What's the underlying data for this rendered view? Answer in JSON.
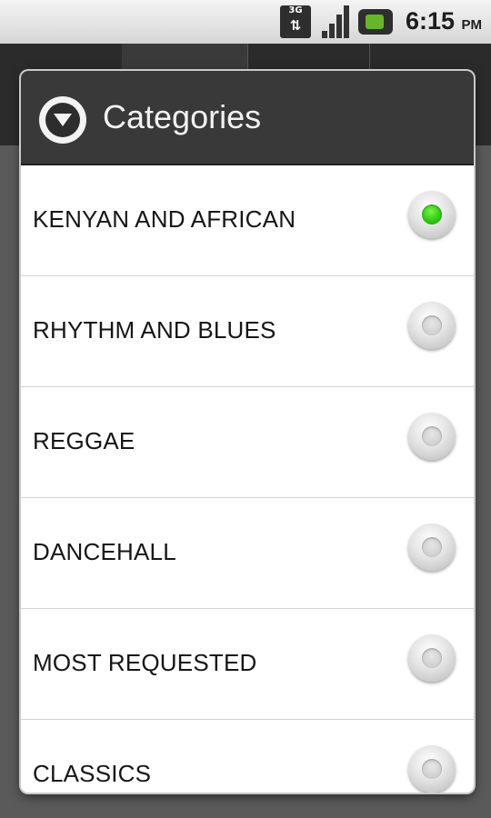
{
  "status_bar": {
    "network_label": "3G",
    "time": "6:15",
    "ampm": "PM",
    "icons": [
      "3g-data-icon",
      "signal-strength-icon",
      "battery-icon"
    ]
  },
  "dialog": {
    "title": "Categories",
    "selected_color": "#2fcb14",
    "options": [
      {
        "label": "KENYAN AND AFRICAN",
        "selected": true
      },
      {
        "label": "RHYTHM AND BLUES",
        "selected": false
      },
      {
        "label": "REGGAE",
        "selected": false
      },
      {
        "label": "DANCEHALL",
        "selected": false
      },
      {
        "label": "MOST REQUESTED",
        "selected": false
      },
      {
        "label": "CLASSICS",
        "selected": false
      }
    ]
  }
}
